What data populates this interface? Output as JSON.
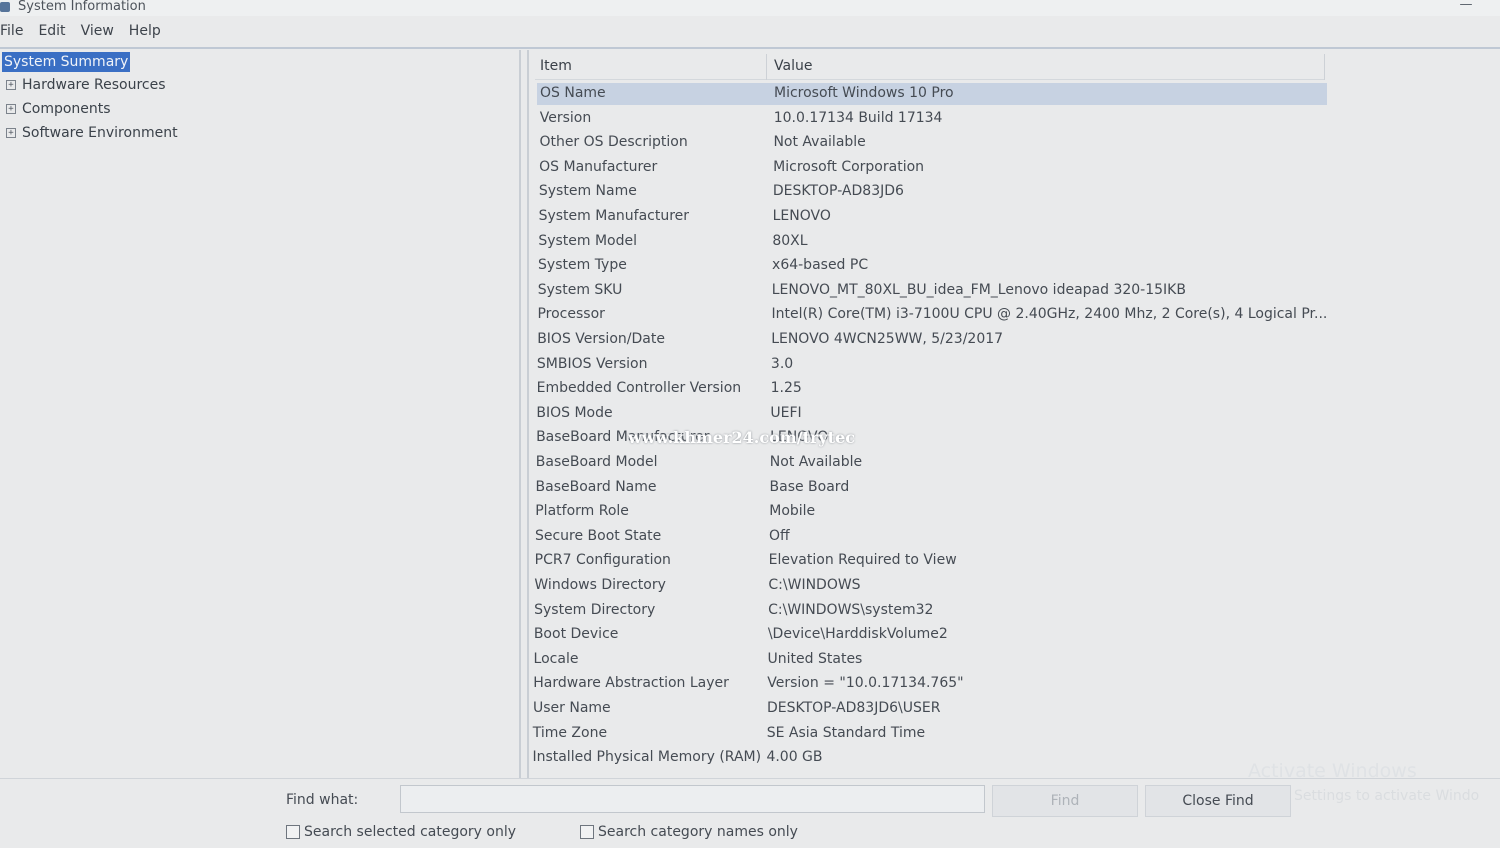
{
  "window": {
    "title": "System Information"
  },
  "menu": [
    "File",
    "Edit",
    "View",
    "Help"
  ],
  "tree": {
    "selected": "System Summary",
    "items": [
      "Hardware Resources",
      "Components",
      "Software Environment"
    ]
  },
  "table": {
    "headers": {
      "item": "Item",
      "value": "Value"
    },
    "rows": [
      {
        "item": "OS Name",
        "value": "Microsoft Windows 10 Pro"
      },
      {
        "item": "Version",
        "value": "10.0.17134 Build 17134"
      },
      {
        "item": "Other OS Description",
        "value": "Not Available"
      },
      {
        "item": "OS Manufacturer",
        "value": "Microsoft Corporation"
      },
      {
        "item": "System Name",
        "value": "DESKTOP-AD83JD6"
      },
      {
        "item": "System Manufacturer",
        "value": "LENOVO"
      },
      {
        "item": "System Model",
        "value": "80XL"
      },
      {
        "item": "System Type",
        "value": "x64-based PC"
      },
      {
        "item": "System SKU",
        "value": "LENOVO_MT_80XL_BU_idea_FM_Lenovo ideapad 320-15IKB"
      },
      {
        "item": "Processor",
        "value": "Intel(R) Core(TM) i3-7100U CPU @ 2.40GHz, 2400 Mhz, 2 Core(s), 4 Logical Pr..."
      },
      {
        "item": "BIOS Version/Date",
        "value": "LENOVO 4WCN25WW, 5/23/2017"
      },
      {
        "item": "SMBIOS Version",
        "value": "3.0"
      },
      {
        "item": "Embedded Controller Version",
        "value": "1.25"
      },
      {
        "item": "BIOS Mode",
        "value": "UEFI"
      },
      {
        "item": "BaseBoard Manufacturer",
        "value": "LENOVO"
      },
      {
        "item": "BaseBoard Model",
        "value": "Not Available"
      },
      {
        "item": "BaseBoard Name",
        "value": "Base Board"
      },
      {
        "item": "Platform Role",
        "value": "Mobile"
      },
      {
        "item": "Secure Boot State",
        "value": "Off"
      },
      {
        "item": "PCR7 Configuration",
        "value": "Elevation Required to View"
      },
      {
        "item": "Windows Directory",
        "value": "C:\\WINDOWS"
      },
      {
        "item": "System Directory",
        "value": "C:\\WINDOWS\\system32"
      },
      {
        "item": "Boot Device",
        "value": "\\Device\\HarddiskVolume2"
      },
      {
        "item": "Locale",
        "value": "United States"
      },
      {
        "item": "Hardware Abstraction Layer",
        "value": "Version = \"10.0.17134.765\""
      },
      {
        "item": "User Name",
        "value": "DESKTOP-AD83JD6\\USER"
      },
      {
        "item": "Time Zone",
        "value": "SE Asia Standard Time"
      },
      {
        "item": "Installed Physical Memory (RAM)",
        "value": "4.00 GB"
      }
    ]
  },
  "watermark": "www.khmer24.com/trytec",
  "activation": {
    "title": "Activate Windows",
    "subtitle": "Settings to activate Windo"
  },
  "find": {
    "label": "Find what:",
    "value": "",
    "find_button": "Find",
    "close_button": "Close Find",
    "check_selected": "Search selected category only",
    "check_names": "Search category names only"
  },
  "colors": {
    "selection": "#3a6fc4",
    "row_highlight": "#c7d2e2"
  }
}
